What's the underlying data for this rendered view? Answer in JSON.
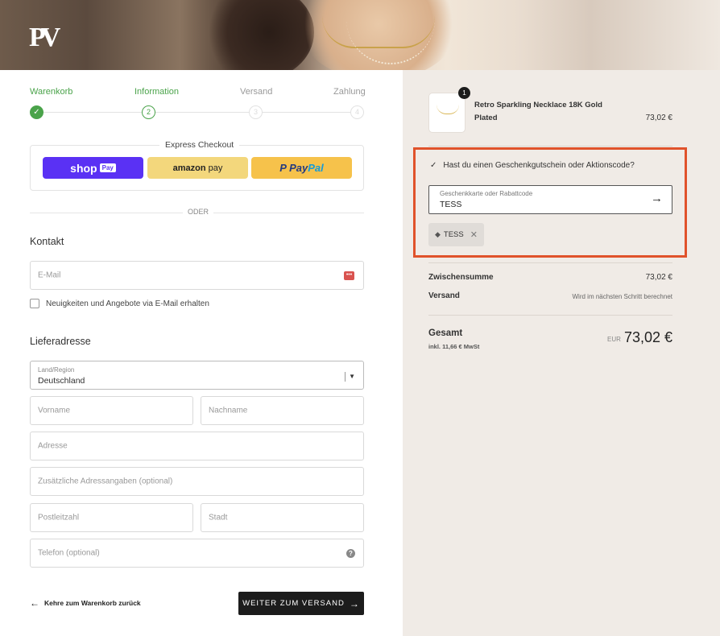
{
  "brand": {
    "logo_text": "PV"
  },
  "steps": [
    {
      "label": "Warenkorb",
      "marker": "✓",
      "state": "done"
    },
    {
      "label": "Information",
      "marker": "2",
      "state": "active"
    },
    {
      "label": "Versand",
      "marker": "3",
      "state": "pending"
    },
    {
      "label": "Zahlung",
      "marker": "4",
      "state": "pending"
    }
  ],
  "express": {
    "title": "Express Checkout",
    "shop_label": "shop",
    "shop_chip": "Pay",
    "amazon_label": "amazon",
    "amazon_suffix": " pay",
    "paypal_label": "Pay",
    "paypal_label2": "Pal",
    "paypal_mark": "P "
  },
  "divider_text": "ODER",
  "contact": {
    "title": "Kontakt",
    "email_placeholder": "E-Mail",
    "newsletter_label": "Neuigkeiten und Angebote via E-Mail erhalten"
  },
  "shipping": {
    "title": "Lieferadresse",
    "country_label": "Land/Region",
    "country_value": "Deutschland",
    "first_name": "Vorname",
    "last_name": "Nachname",
    "address": "Adresse",
    "address2": "Zusätzliche Adressangaben (optional)",
    "zip": "Postleitzahl",
    "city": "Stadt",
    "phone": "Telefon (optional)"
  },
  "actions": {
    "back_label": "Kehre zum Warenkorb zurück",
    "continue_label": "WEITER ZUM VERSAND"
  },
  "cart": {
    "quantity": "1",
    "product_name": "Retro Sparkling Necklace 18K Gold Plated",
    "product_price": "73,02 €"
  },
  "discount": {
    "toggle_label": "Hast du einen Geschenkgutschein oder Aktionscode?",
    "field_label": "Geschenkkarte oder Rabattcode",
    "field_value": "TESS",
    "applied_code": "TESS"
  },
  "summary": {
    "subtotal_label": "Zwischensumme",
    "subtotal_value": "73,02 €",
    "shipping_label": "Versand",
    "shipping_value": "Wird im nächsten Schritt berechnet",
    "total_label": "Gesamt",
    "tax_note": "inkl. 11,66 € MwSt",
    "currency": "EUR",
    "total_value": "73,02 €"
  },
  "colors": {
    "accent_green": "#4aa34a",
    "highlight_border": "#e0522b",
    "shop_pay": "#5a31f4",
    "amazon_pay": "#f3d77c",
    "paypal": "#f6c24b",
    "panel_bg": "#f0ebe6"
  }
}
